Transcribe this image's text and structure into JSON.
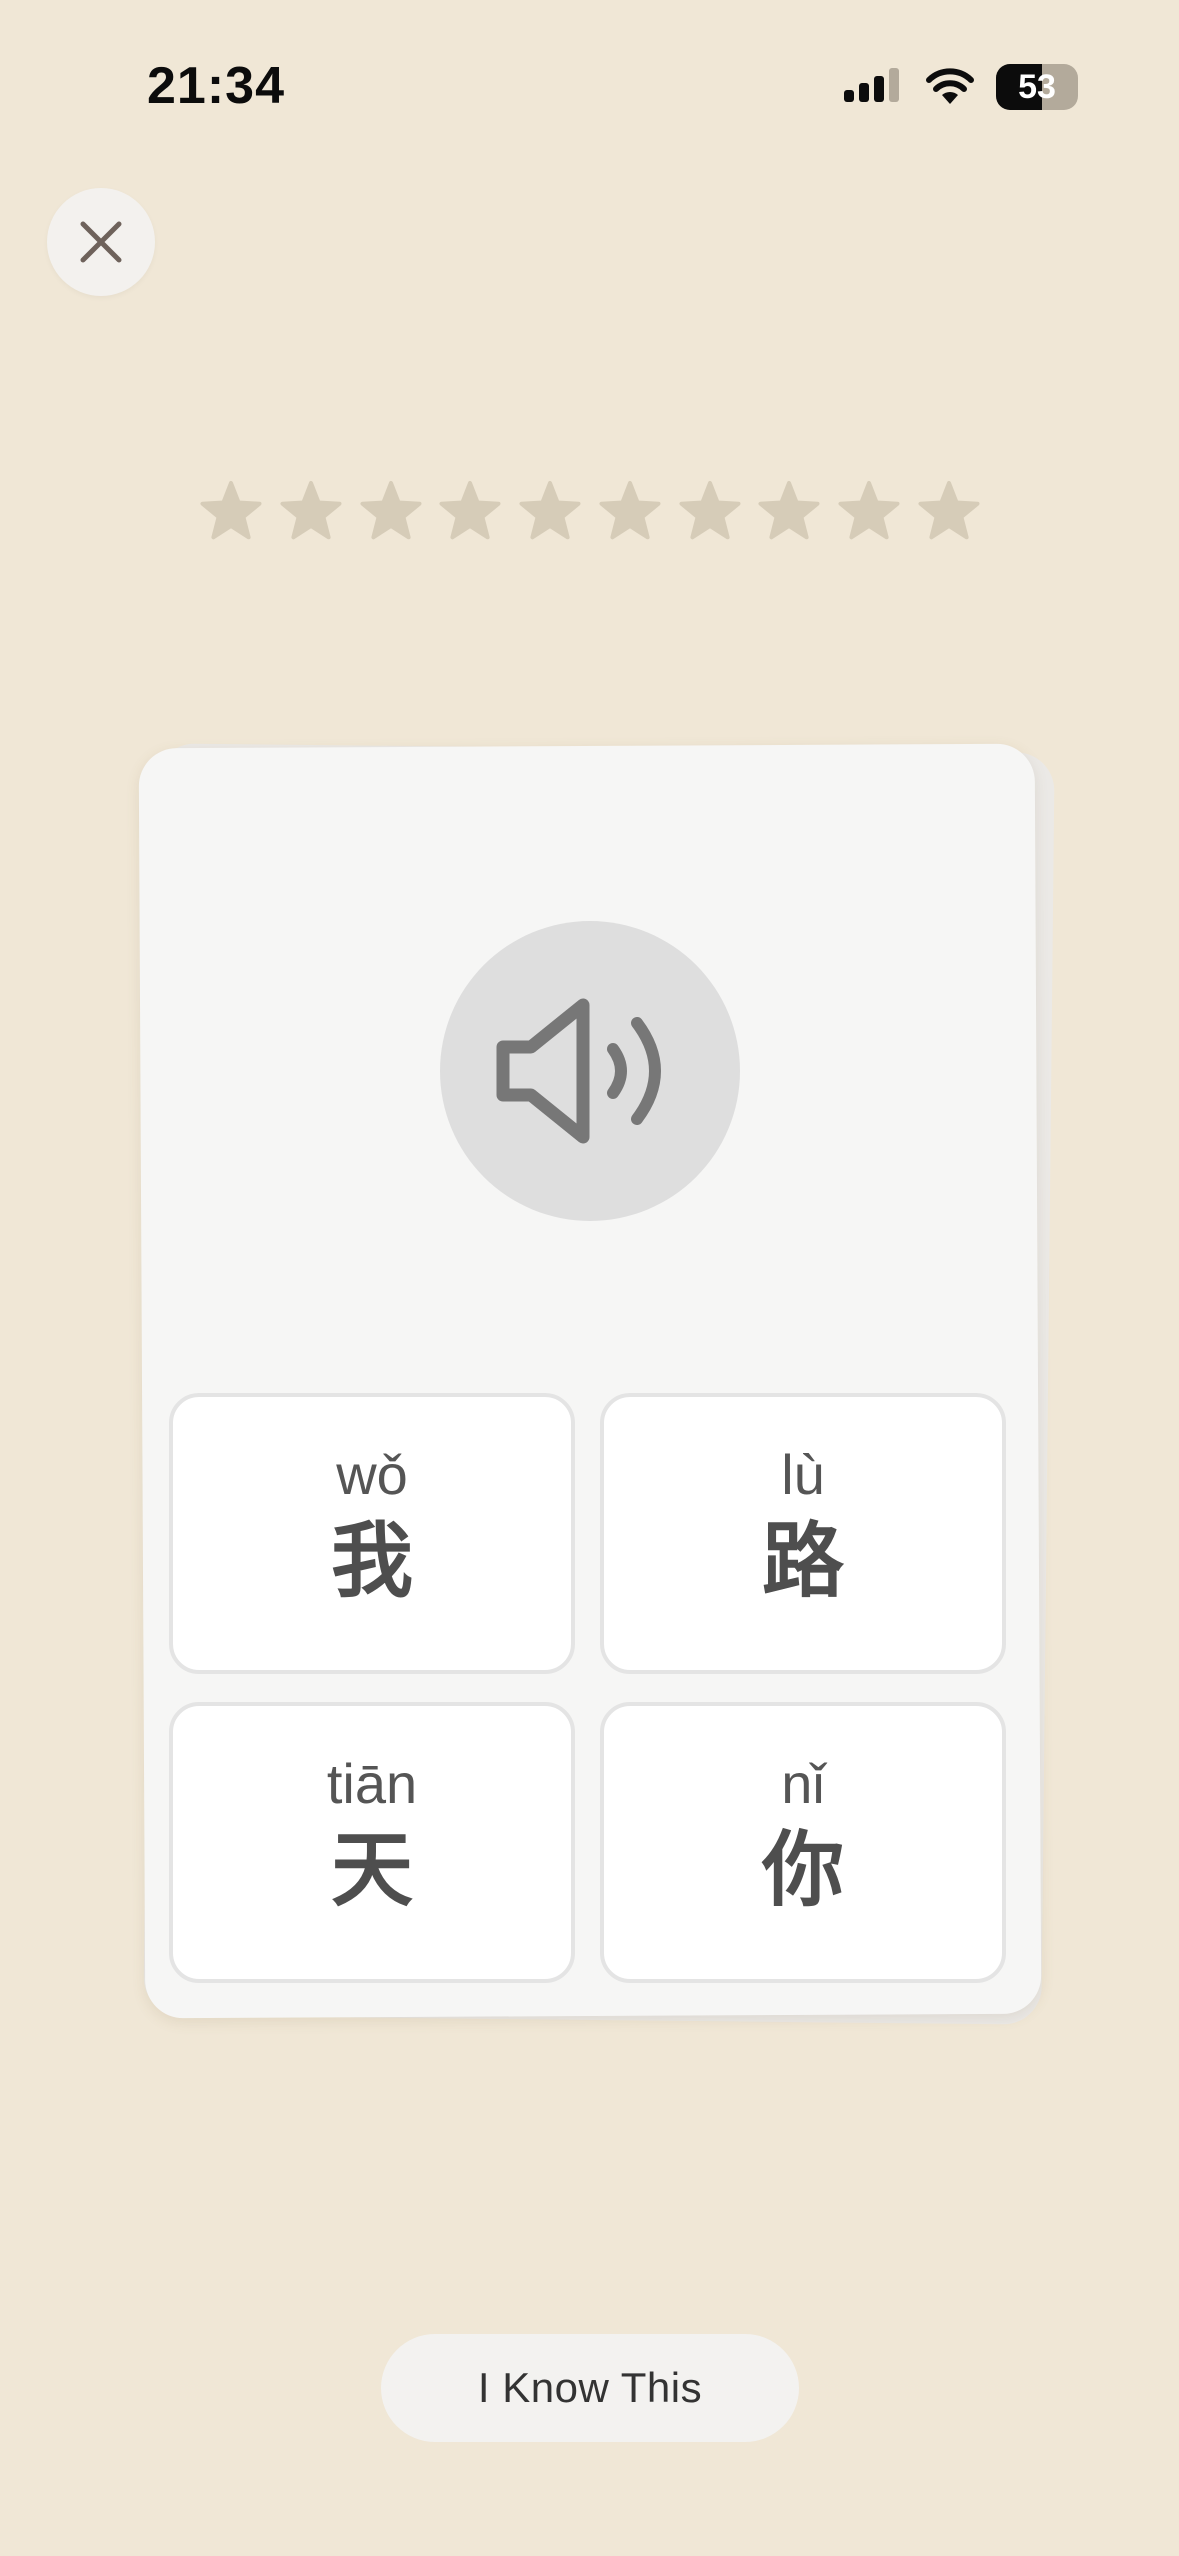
{
  "status_bar": {
    "time": "21:34",
    "battery_percent": "53"
  },
  "progress": {
    "total_stars": 10,
    "filled_stars": 0
  },
  "question": {
    "prompt": "speaker-icon",
    "options": [
      {
        "pinyin": "wǒ",
        "hanzi": "我"
      },
      {
        "pinyin": "lù",
        "hanzi": "路"
      },
      {
        "pinyin": "tiān",
        "hanzi": "天"
      },
      {
        "pinyin": "nǐ",
        "hanzi": "你"
      }
    ]
  },
  "actions": {
    "know_label": "I Know This"
  },
  "colors": {
    "background": "#f0e7d6",
    "star_empty": "#d6ccb8",
    "card": "#f6f6f5",
    "speaker_circle": "#dedede",
    "icon_gray": "#777777"
  },
  "icons": {
    "close": "close-icon",
    "speaker": "speaker-icon",
    "star": "star-icon"
  }
}
